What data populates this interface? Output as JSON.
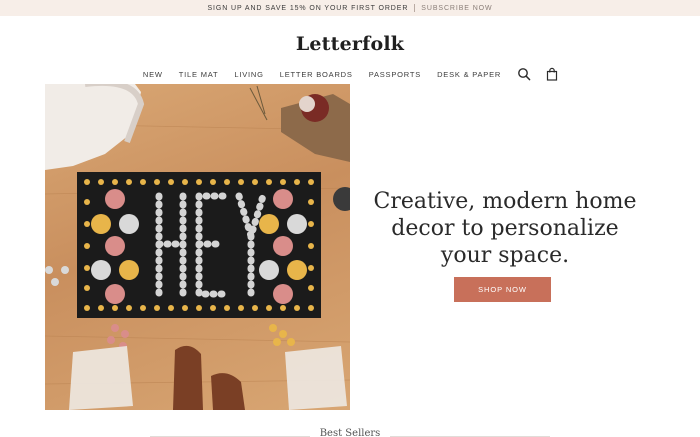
{
  "promo": {
    "message": "SIGN UP AND SAVE 15% ON YOUR FIRST ORDER",
    "link": "SUBSCRIBE NOW"
  },
  "brand": {
    "logo": "Letterfolk"
  },
  "nav": {
    "items": [
      "NEW",
      "TILE MAT",
      "LIVING",
      "LETTER BOARDS",
      "PASSPORTS",
      "DESK & PAPER"
    ],
    "icons": [
      "search-icon",
      "bag-icon"
    ]
  },
  "hero": {
    "headline_line1": "Creative, modern home",
    "headline_line2": "decor to personalize",
    "headline_line3": "your space.",
    "cta": "SHOP NOW",
    "mat_text": "HEY"
  },
  "section": {
    "title": "Best Sellers"
  },
  "colors": {
    "accent": "#c8705a",
    "promo_bg": "#f7eee8",
    "mat": "#1b1b1b",
    "tile_yellow": "#e8b54a",
    "tile_pink": "#d98d8a",
    "tile_white": "#d9d9d9"
  }
}
